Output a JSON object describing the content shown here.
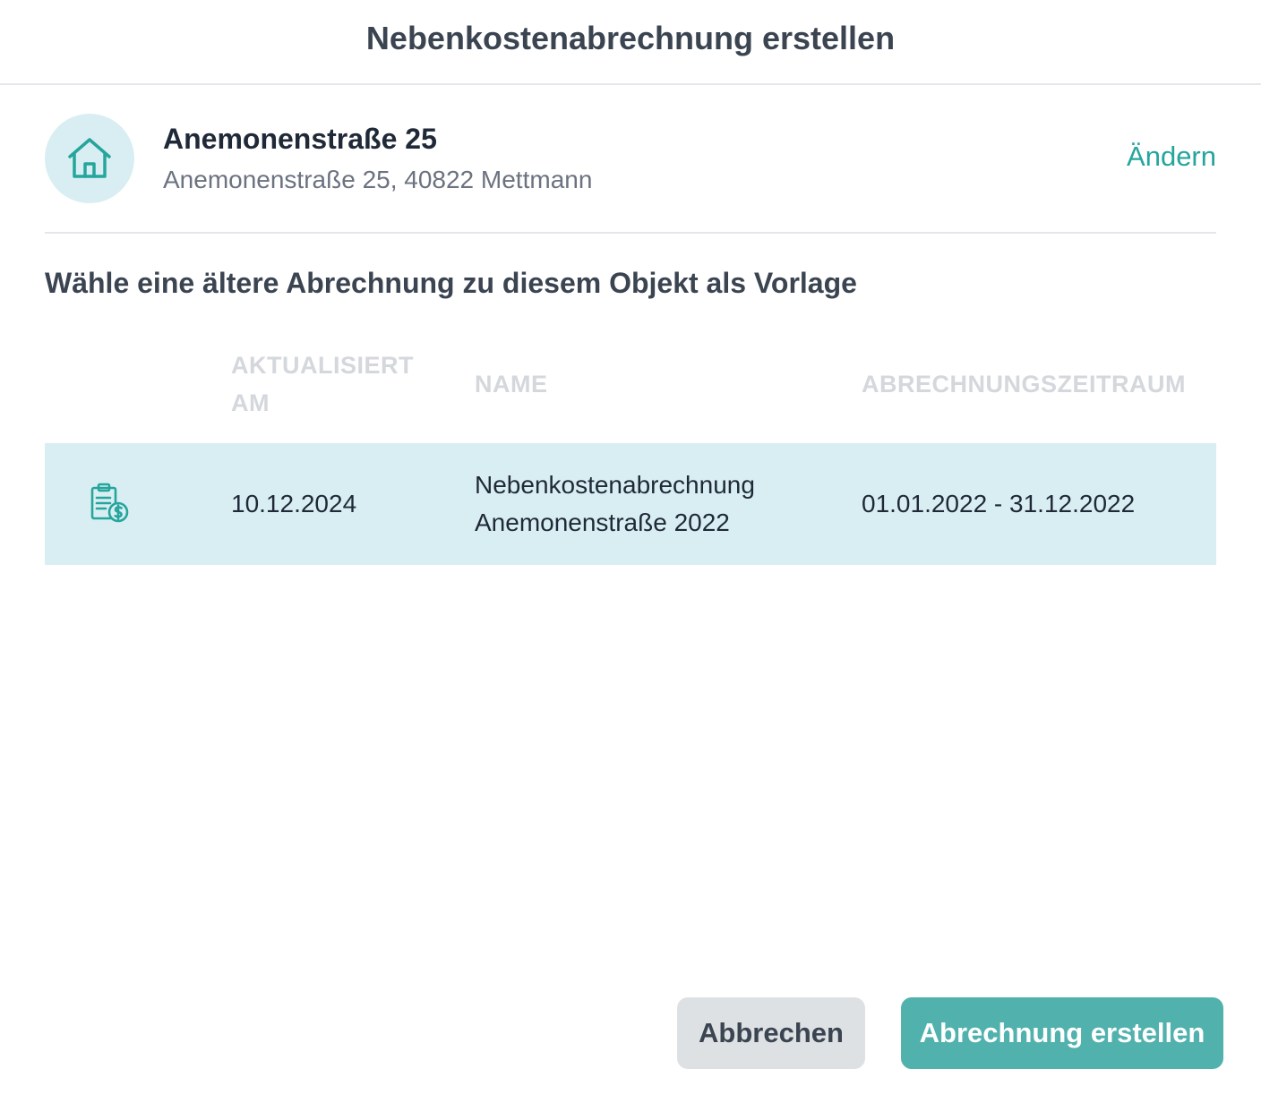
{
  "dialog": {
    "title": "Nebenkostenabrechnung erstellen"
  },
  "property": {
    "icon": "house-icon",
    "name": "Anemonenstraße 25",
    "address": "Anemonenstraße 25, 40822 Mettmann",
    "change_label": "Ändern"
  },
  "instruction": "Wähle eine ältere Abrechnung zu diesem Objekt als Vorlage",
  "table": {
    "columns": {
      "updated": "AKTUALISIERT AM",
      "name": "NAME",
      "period": "ABRECHNUNGSZEITRAUM"
    },
    "rows": [
      {
        "icon": "clipboard-invoice-icon",
        "updated": "10.12.2024",
        "name": "Nebenkostenabrechnung Anemonenstraße 2022",
        "period": "01.01.2022 - 31.12.2022"
      }
    ]
  },
  "footer": {
    "cancel_label": "Abbrechen",
    "create_label": "Abrechnung erstellen"
  },
  "colors": {
    "accent": "#25a59c",
    "primary_button": "#51b1ad",
    "selected_row": "#d9eef3",
    "avatar_bg": "#d9eef2"
  }
}
